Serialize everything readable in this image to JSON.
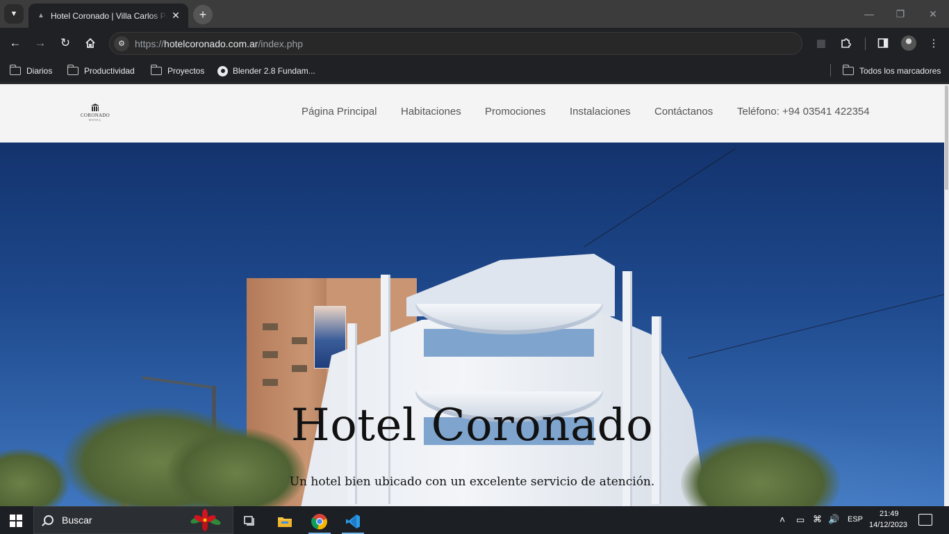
{
  "browser": {
    "tab_title": "Hotel Coronado | Villa Carlos Paz",
    "url_scheme": "https://",
    "url_host": "hotelcoronado.com.ar",
    "url_path": "/index.php",
    "bookmarks": [
      "Diarios",
      "Productividad",
      "Proyectos",
      "Blender 2.8 Fundam..."
    ],
    "all_bookmarks": "Todos los marcadores",
    "icons": {
      "tab_search": "chevron-down-icon",
      "close_tab": "close-icon",
      "new_tab": "plus-icon",
      "back": "arrow-left-icon",
      "forward": "arrow-right-icon",
      "reload": "reload-icon",
      "home": "home-icon",
      "extensions": "puzzle-icon",
      "side_panel": "side-panel-icon",
      "menu": "kebab-menu-icon"
    }
  },
  "site": {
    "logo_name": "CORONADO",
    "logo_sub": "HOTEL",
    "nav": [
      "Página Principal",
      "Habitaciones",
      "Promociones",
      "Instalaciones",
      "Contáctanos",
      "Teléfono: +94 03541 422354"
    ],
    "hero_title": "Hotel Coronado",
    "hero_subtitle": "Un hotel bien ubicado con un excelente servicio de atención.",
    "colors": {
      "header_bg": "#f4f4f4",
      "nav_text": "#555555",
      "back_to_top": "#1e3048"
    }
  },
  "taskbar": {
    "search_placeholder": "Buscar",
    "language": "ESP",
    "time": "21:49",
    "date": "14/12/2023",
    "apps": [
      "task-view-icon",
      "file-explorer-icon",
      "chrome-icon",
      "vscode-icon"
    ]
  }
}
